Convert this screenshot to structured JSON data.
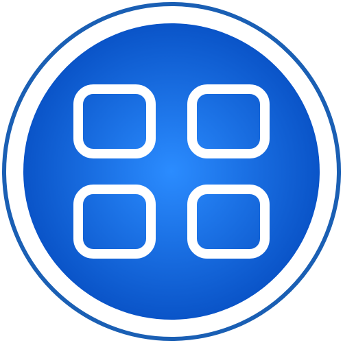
{
  "app_icon": {
    "icon": "grid-apps-icon",
    "tile_count": 4,
    "colors": {
      "background": "#ffffff",
      "ring": "#1a5fb4",
      "badge_center": "#2b8cff",
      "badge_edge": "#0a54c8",
      "tile_stroke": "#ffffff"
    }
  }
}
